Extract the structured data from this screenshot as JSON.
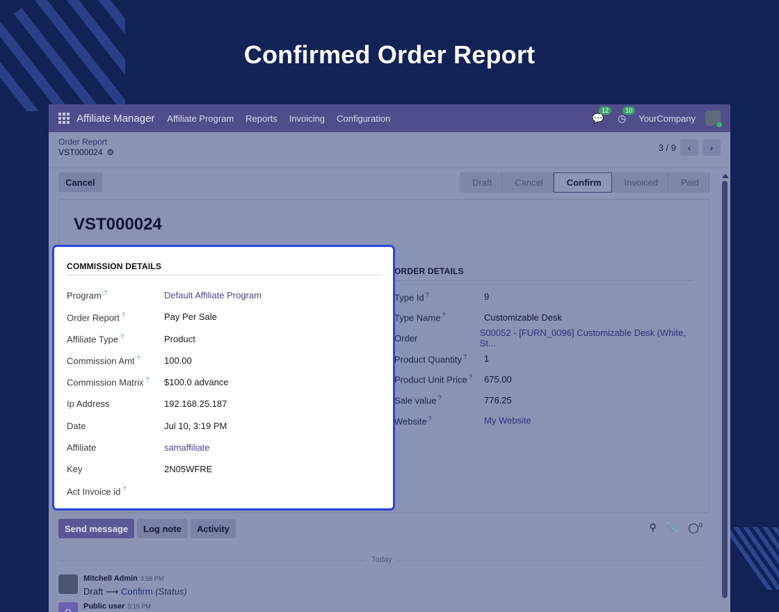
{
  "page_title": "Confirmed Order Report",
  "navbar": {
    "app_name": "Affiliate Manager",
    "menu": [
      "Affiliate Program",
      "Reports",
      "Invoicing",
      "Configuration"
    ],
    "messages_count": "12",
    "activities_count": "10",
    "company": "YourCompany"
  },
  "breadcrumb": {
    "parent": "Order Report",
    "current": "VST000024"
  },
  "pager": {
    "value": "3 / 9"
  },
  "actions": {
    "cancel": "Cancel"
  },
  "statusbar": {
    "steps": [
      "Draft",
      "Cancel",
      "Confirm",
      "Invoiced",
      "Paid"
    ],
    "active": "Confirm"
  },
  "record": {
    "title": "VST000024"
  },
  "commission_details": {
    "heading": "COMMISSION DETAILS",
    "rows": [
      {
        "label": "Program",
        "help": "?",
        "value": "Default Affiliate Program",
        "link": true
      },
      {
        "label": "Order Report",
        "help": "?",
        "value": "Pay Per Sale",
        "link": false
      },
      {
        "label": "Affiliate Type",
        "help": "?",
        "value": "Product",
        "link": false
      },
      {
        "label": "Commission Amt",
        "help": "?",
        "value": "100.00",
        "link": false
      },
      {
        "label": "Commission Matrix",
        "help": "?",
        "value": "$100.0 advance",
        "link": false
      },
      {
        "label": "Ip Address",
        "help": "",
        "value": "192.168.25.187",
        "link": false
      },
      {
        "label": "Date",
        "help": "",
        "value": "Jul 10, 3:19 PM",
        "link": false
      },
      {
        "label": "Affiliate",
        "help": "",
        "value": "samaffiliate",
        "link": true
      },
      {
        "label": "Key",
        "help": "",
        "value": "2N05WFRE",
        "link": false
      },
      {
        "label": "Act Invoice id",
        "help": "?",
        "value": "",
        "link": false
      }
    ]
  },
  "order_details": {
    "heading": "ORDER DETAILS",
    "rows": [
      {
        "label": "Type Id",
        "help": "?",
        "value": "9",
        "link": false
      },
      {
        "label": "Type Name",
        "help": "?",
        "value": "Customizable Desk",
        "link": false
      },
      {
        "label": "Order",
        "help": "",
        "value": "S00052 - [FURN_0096] Customizable Desk (White, St...",
        "link": true
      },
      {
        "label": "Product Quantity",
        "help": "?",
        "value": "1",
        "link": false
      },
      {
        "label": "Product Unit Price",
        "help": "?",
        "value": "675.00",
        "link": false
      },
      {
        "label": "Sale value",
        "help": "?",
        "value": "776.25",
        "link": false
      },
      {
        "label": "Website",
        "help": "?",
        "value": "My Website",
        "link": true
      }
    ]
  },
  "chatter": {
    "send_message": "Send message",
    "log_note": "Log note",
    "activity": "Activity",
    "followers_count": "0",
    "separator": "Today",
    "messages": [
      {
        "author": "Mitchell Admin",
        "time": "3:58 PM",
        "from": "Draft",
        "to": "Confirm",
        "field": "(Status)"
      },
      {
        "author": "Public user",
        "time": "3:19 PM",
        "avatar_letter": "P"
      }
    ]
  }
}
